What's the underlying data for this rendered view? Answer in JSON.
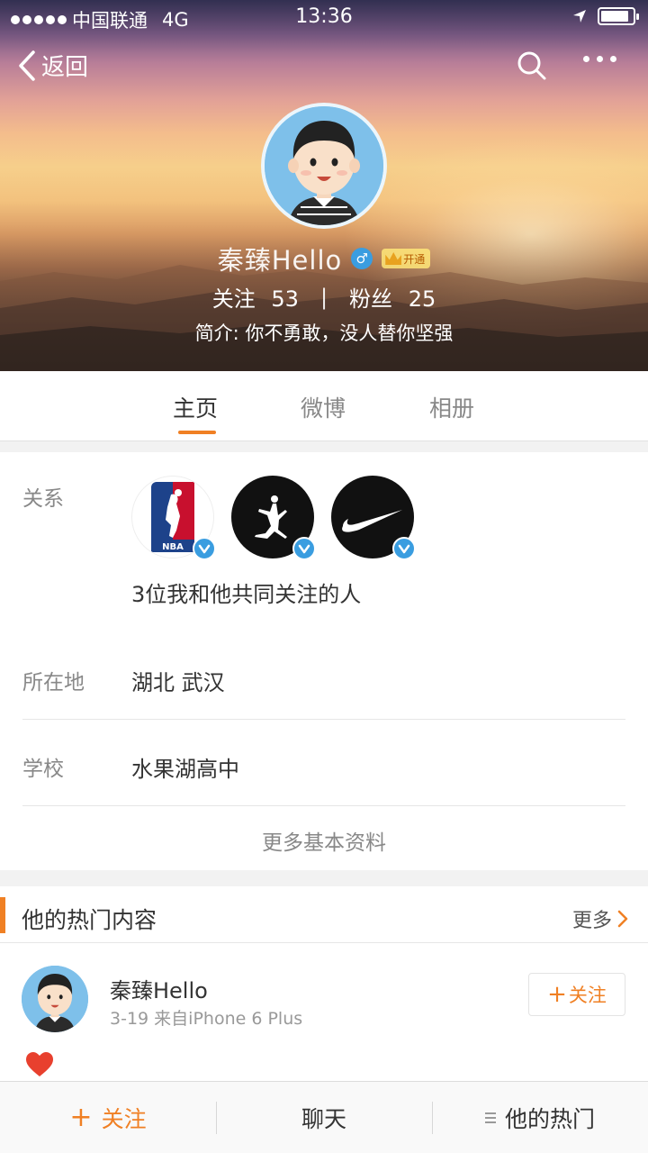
{
  "status_bar": {
    "carrier": "中国联通",
    "network": "4G",
    "time": "13:36"
  },
  "nav": {
    "back_label": "返回"
  },
  "profile": {
    "name": "秦臻Hello",
    "gender_symbol": "♂",
    "vip_badge": "开通",
    "following_label": "关注",
    "following_count": "53",
    "stats_separator": "|",
    "followers_label": "粉丝",
    "followers_count": "25",
    "bio": "简介: 你不勇敢，没人替你坚强"
  },
  "tabs": [
    {
      "label": "主页",
      "active": true
    },
    {
      "label": "微博",
      "active": false
    },
    {
      "label": "相册",
      "active": false
    }
  ],
  "info": {
    "relation_label": "关系",
    "relation_brands": [
      "NBA",
      "Jordan",
      "Nike"
    ],
    "nba_logo_text": "NBA",
    "mutual_text": "3位我和他共同关注的人",
    "location_label": "所在地",
    "location_value": "湖北 武汉",
    "school_label": "学校",
    "school_value": "水果湖高中",
    "more_info": "更多基本资料"
  },
  "hot": {
    "title": "他的热门内容",
    "more": "更多",
    "post": {
      "author": "秦臻Hello",
      "meta": "3-19  来自iPhone 6 Plus",
      "follow_button": "关注"
    }
  },
  "bottom_bar": {
    "follow": "关注",
    "chat": "聊天",
    "hot": "他的热门"
  },
  "colors": {
    "accent": "#f08024",
    "verified_blue": "#3a9de0"
  }
}
